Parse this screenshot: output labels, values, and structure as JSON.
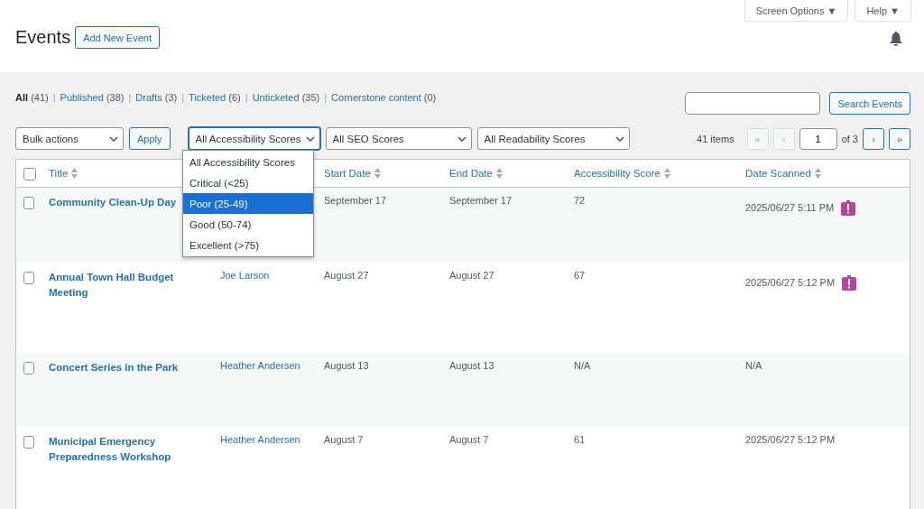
{
  "header": {
    "title": "Events",
    "add_button": "Add New Event",
    "screen_options": "Screen Options ▼",
    "help": "Help ▼"
  },
  "views": [
    {
      "label": "All",
      "count": "(41)",
      "selected": true
    },
    {
      "separator": "|",
      "label": "Published",
      "count": "(38)",
      "selected": false
    },
    {
      "separator": "|",
      "label": "Drafts",
      "count": "(3)",
      "selected": false
    },
    {
      "separator": "|",
      "label": "Ticketed",
      "count": "(6)",
      "selected": false
    },
    {
      "separator": "|",
      "label": "Unticketed",
      "count": "(35)",
      "selected": false
    },
    {
      "separator": "|",
      "label": "Cornerstone content",
      "count": "(0)",
      "selected": false
    }
  ],
  "search": {
    "button": "Search Events"
  },
  "bulk": {
    "value": "Bulk actions",
    "apply": "Apply"
  },
  "filters": [
    {
      "value": "All Accessibility Scores",
      "open": true
    },
    {
      "value": "All SEO Scores",
      "open": false
    },
    {
      "value": "All Readability Scores",
      "open": false
    }
  ],
  "dropdown_options": [
    {
      "label": "All Accessibility Scores",
      "selected": false
    },
    {
      "label": "Critical (<25)",
      "selected": false
    },
    {
      "label": "Poor (25-49)",
      "selected": true
    },
    {
      "label": "Good (50-74)",
      "selected": false
    },
    {
      "label": "Excellent (>75)",
      "selected": false
    }
  ],
  "pagination": {
    "items": "41 items",
    "page": "1",
    "of": "of 3",
    "nav": [
      {
        "label": "«",
        "disabled": true
      },
      {
        "label": "‹",
        "disabled": true
      },
      {
        "label": "›",
        "disabled": false
      },
      {
        "label": "»",
        "disabled": false
      }
    ]
  },
  "select_all_checked": false,
  "columns": [
    {
      "label": "Title"
    },
    {
      "label": "Start Date"
    },
    {
      "label": "End Date"
    },
    {
      "label": "Accessibility Score"
    },
    {
      "label": "Date Scanned"
    }
  ],
  "rows": [
    {
      "checked": false,
      "title": "Community Clean-Up Day",
      "start": "September 17",
      "end": "September 17",
      "score": "72",
      "scanned": "2025/06/27 5:11 PM",
      "flagged": true
    },
    {
      "checked": false,
      "title": "Annual Town Hall Budget Meeting",
      "author": "Joe Larson",
      "start": "August 27",
      "end": "August 27",
      "score": "67",
      "scanned": "2025/06/27 5:12 PM",
      "flagged": true
    },
    {
      "checked": false,
      "title": "Concert Series in the Park",
      "author": "Heather Andersen",
      "start": "August 13",
      "end": "August 13",
      "score": "N/A",
      "scanned": "N/A",
      "flagged": false
    },
    {
      "checked": false,
      "title": "Municipal Emergency Preparedness Workshop",
      "author": "Heather Andersen",
      "start": "August 7",
      "end": "August 7",
      "score": "61",
      "scanned": "2025/06/27 5:12 PM",
      "flagged": false
    }
  ]
}
